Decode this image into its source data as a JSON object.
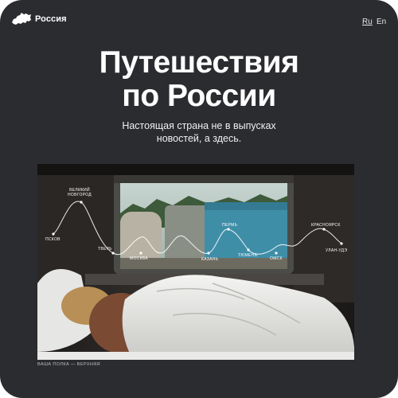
{
  "header": {
    "brand": "Россия",
    "lang_ru": "Ru",
    "lang_en": "En"
  },
  "hero": {
    "title_line1": "Путешествия",
    "title_line2": "по России",
    "subtitle_line1": "Настоящая страна не в выпусках",
    "subtitle_line2": "новостей, а здесь."
  },
  "photo": {
    "caption": "ВАША ПОЛКА — ВЕРХНЯЯ"
  },
  "route": {
    "cities": [
      {
        "name": "Великий Новгород",
        "line1": "Великий",
        "line2": "Новгород"
      },
      {
        "name": "Псков",
        "line1": "Псков"
      },
      {
        "name": "Тверь",
        "line1": "Тверь"
      },
      {
        "name": "Москва",
        "line1": "Москва"
      },
      {
        "name": "Пермь",
        "line1": "Пермь"
      },
      {
        "name": "Казань",
        "line1": "Казань"
      },
      {
        "name": "Тюмень",
        "line1": "Тюмень"
      },
      {
        "name": "Омск",
        "line1": "Омск"
      },
      {
        "name": "Красноярск",
        "line1": "Красноярск"
      },
      {
        "name": "Улан-Удэ",
        "line1": "Улан-Удэ"
      }
    ]
  },
  "colors": {
    "background": "#2b2c30",
    "text": "#ffffff"
  }
}
